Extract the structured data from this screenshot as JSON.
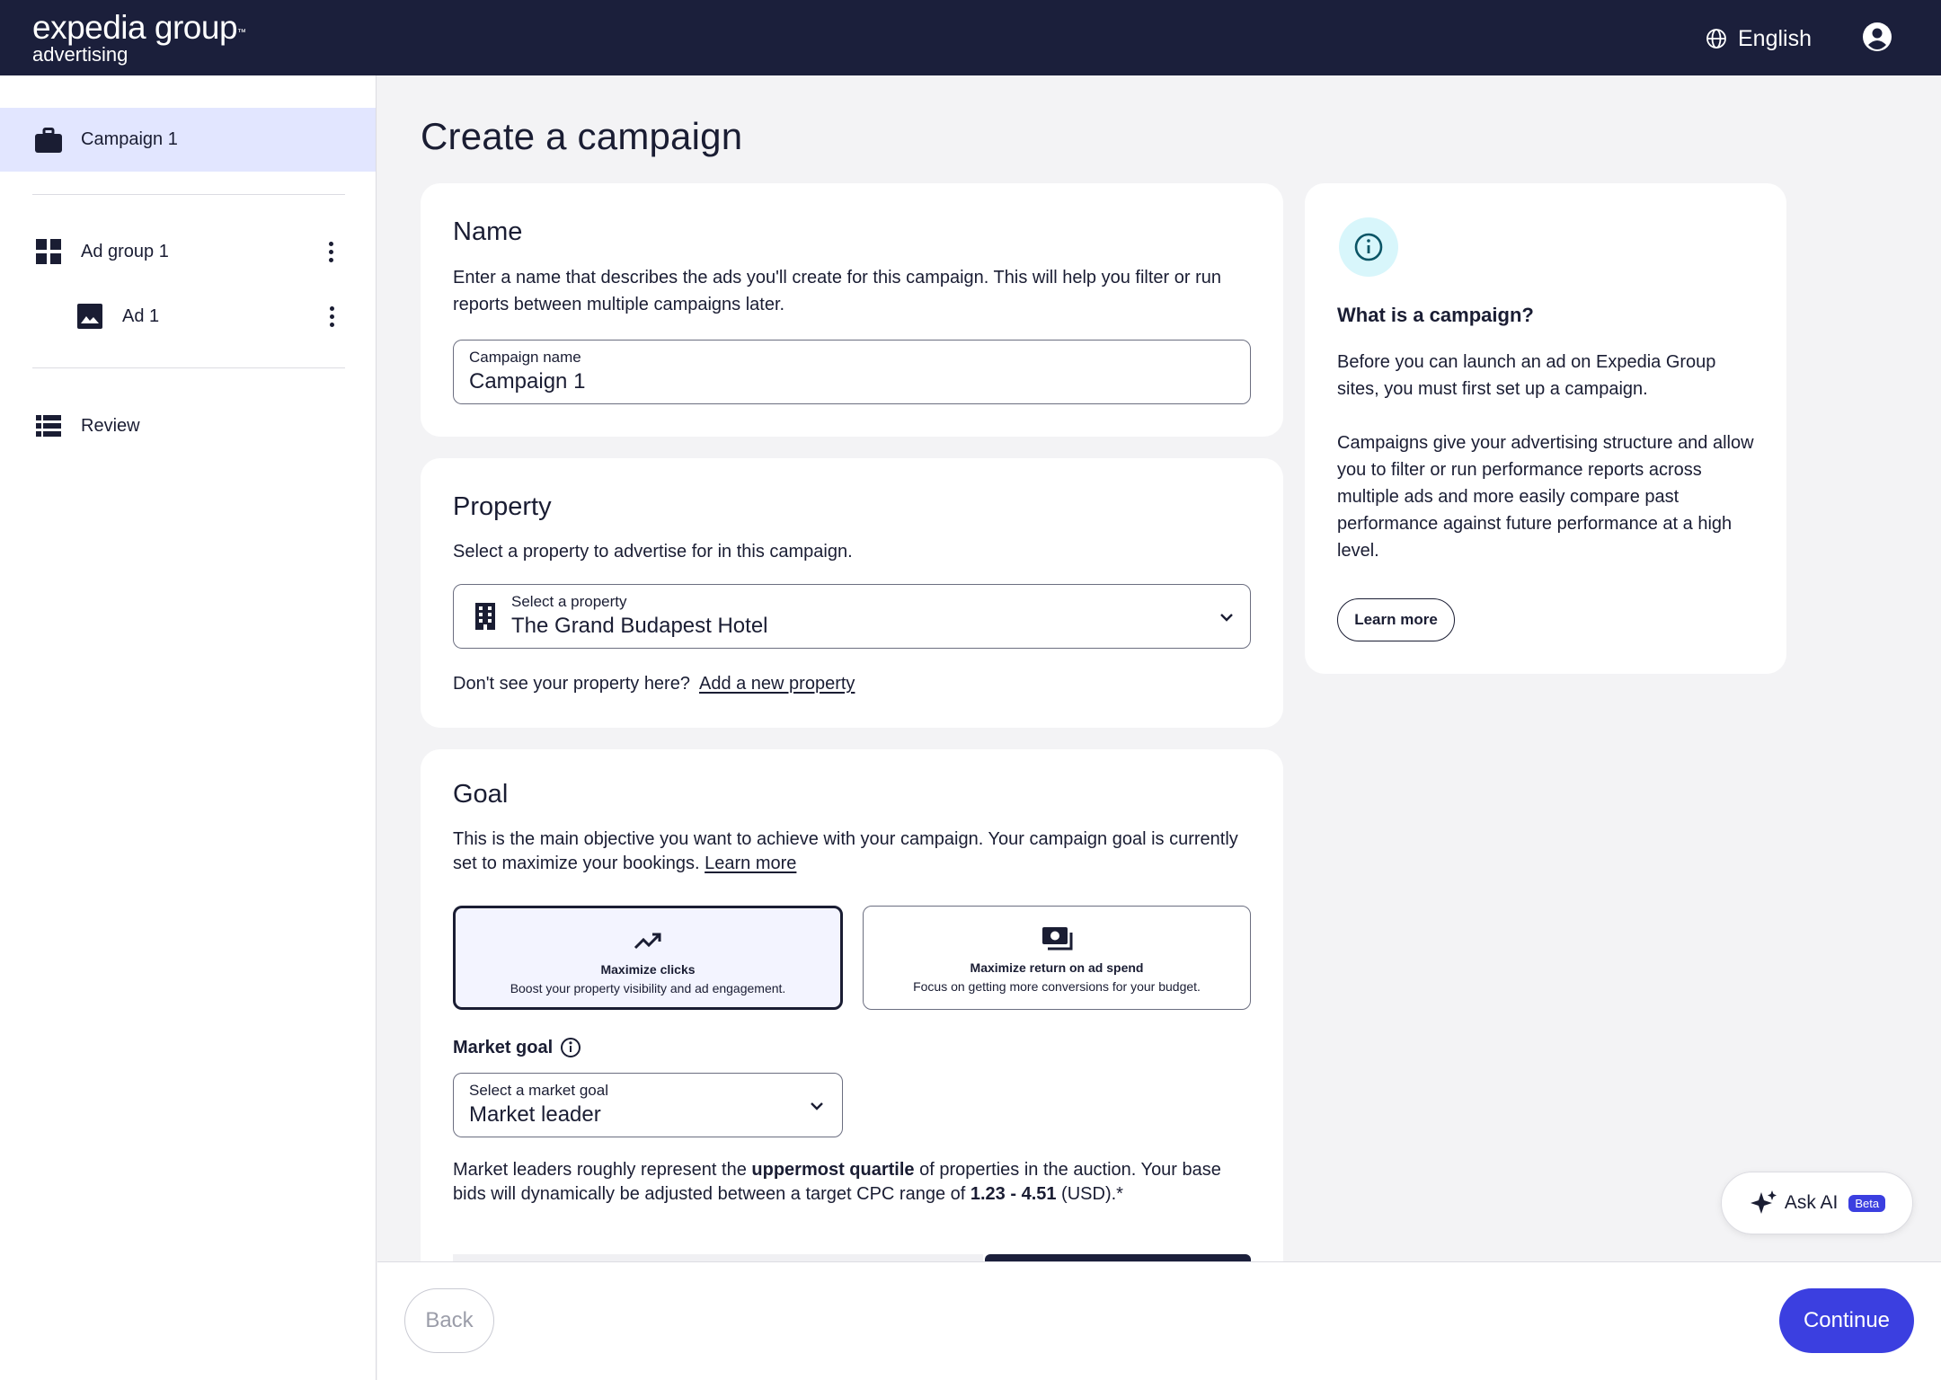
{
  "header": {
    "logo_line1": "expedia group",
    "logo_tm": "™",
    "logo_line2": "advertising",
    "language": "English"
  },
  "sidebar": {
    "campaign": "Campaign 1",
    "ad_group": "Ad group 1",
    "ad": "Ad 1",
    "review": "Review"
  },
  "page": {
    "title": "Create a campaign"
  },
  "name_card": {
    "heading": "Name",
    "description": "Enter a name that describes the ads you'll create for this campaign. This will help you filter or run reports between multiple campaigns later.",
    "field_label": "Campaign name",
    "field_value": "Campaign 1"
  },
  "property_card": {
    "heading": "Property",
    "description": "Select a property to advertise for in this campaign.",
    "select_label": "Select a property",
    "select_value": "The Grand Budapest Hotel",
    "missing_text": "Don't see your property here?",
    "add_link": "Add a new property"
  },
  "goal_card": {
    "heading": "Goal",
    "description": "This is the main objective you want to achieve with your campaign. Your campaign goal is currently set to maximize your bookings.",
    "learn_more": "Learn more",
    "options": [
      {
        "title": "Maximize clicks",
        "desc": "Boost your property visibility and ad engagement.",
        "selected": true
      },
      {
        "title": "Maximize return on ad spend",
        "desc": "Focus on getting more conversions for your budget.",
        "selected": false
      }
    ],
    "market_goal_label": "Market goal",
    "market_select_label": "Select a market goal",
    "market_select_value": "Market leader",
    "market_text_a": "Market leaders roughly represent the ",
    "market_text_b": "uppermost quartile",
    "market_text_c": " of properties in the auction. Your base bids will dynamically be adjusted between a target CPC range of ",
    "market_text_d": "1.23 - 4.51",
    "market_text_e": " (USD).*"
  },
  "info_card": {
    "heading": "What is a campaign?",
    "para1": "Before you can launch an ad on Expedia Group sites, you must first set up a campaign.",
    "para2": "Campaigns give your advertising structure and allow you to filter or run performance reports across multiple ads and more easily compare past performance against future performance at a high level.",
    "button": "Learn more"
  },
  "footer": {
    "back": "Back",
    "continue": "Continue"
  },
  "ask_ai": {
    "label": "Ask AI",
    "badge": "Beta"
  },
  "colors": {
    "header_bg": "#1b1f3b",
    "accent": "#3b3fe0",
    "active_nav": "#e2e6ff",
    "info_icon_bg": "#d8f6fb"
  }
}
